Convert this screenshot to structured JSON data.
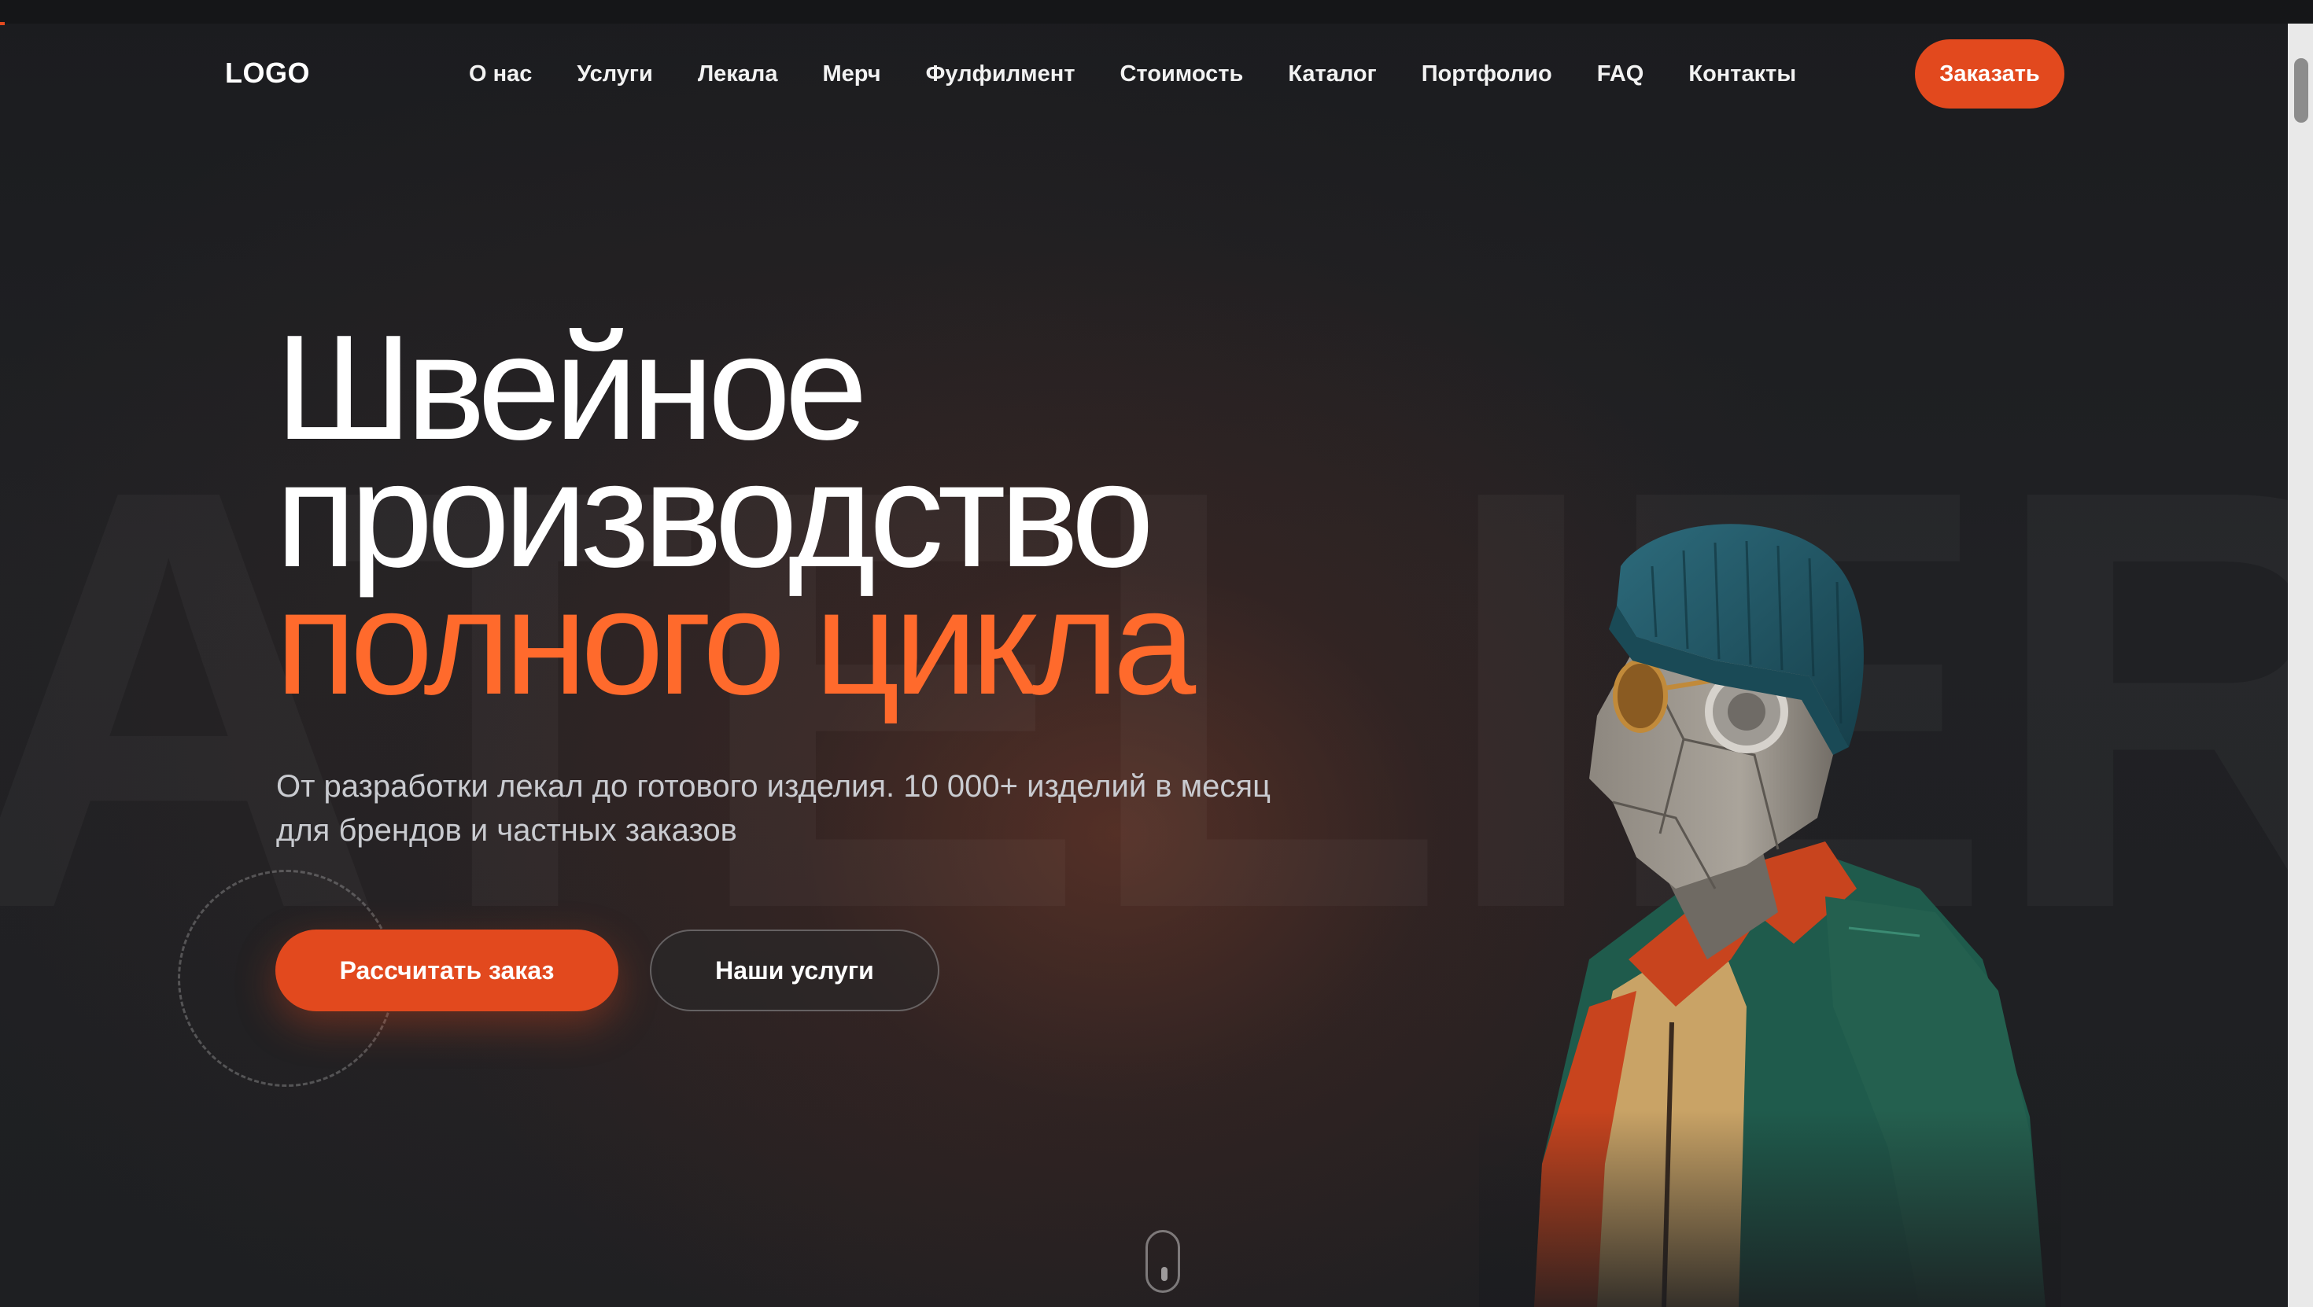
{
  "header": {
    "logo": "LOGO",
    "nav": [
      "О нас",
      "Услуги",
      "Лекала",
      "Мерч",
      "Фулфилмент",
      "Стоимость",
      "Каталог",
      "Портфолио",
      "FAQ",
      "Контакты"
    ],
    "order_button": "Заказать"
  },
  "hero": {
    "watermark": "ATELIER",
    "title_line1": "Швейное",
    "title_line2": "производство",
    "title_line3": "полного цикла",
    "subtitle_line1": "От разработки лекал до готового изделия. 10 000+ изделий в месяц",
    "subtitle_line2": "для брендов и частных заказов",
    "primary_button": "Рассчитать заказ",
    "secondary_button": "Наши услуги"
  },
  "colors": {
    "accent": "#e2491e",
    "accent_text": "#ff6a2c",
    "background": "#1b1c1f"
  },
  "icons": {
    "scroll": "mouse-scroll-icon",
    "hero_image": "robot-in-beanie-illustration"
  }
}
